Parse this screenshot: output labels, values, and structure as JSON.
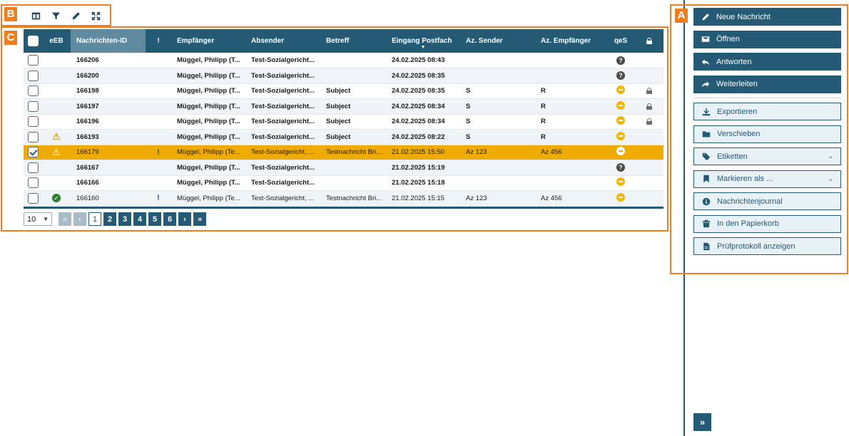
{
  "annotations": {
    "a": "A",
    "b": "B",
    "c": "C"
  },
  "toolbar": {
    "icons": [
      "columns-icon",
      "filter-icon",
      "pen-icon",
      "expand-icon"
    ]
  },
  "table": {
    "headers": {
      "eeb": "eEB",
      "id": "Nachrichten-ID",
      "prio": "!",
      "empf": "Empfänger",
      "abs": "Absender",
      "betreff": "Betreff",
      "eingang": "Eingang Postfach",
      "azs": "Az. Sender",
      "aze": "Az. Empfänger",
      "qes": "qeS"
    },
    "sort_indicator": "▼",
    "rows": [
      {
        "checked": false,
        "eeb": "",
        "id": "166206",
        "prio": "",
        "empf": "Müggel, Philipp (T...",
        "abs": "Test-Sozialgericht...",
        "betreff": "",
        "eingang": "24.02.2025 08:43",
        "azs": "",
        "aze": "",
        "qes": "question",
        "lock": false,
        "bold": true
      },
      {
        "checked": false,
        "eeb": "",
        "id": "166200",
        "prio": "",
        "empf": "Müggel, Philipp (T...",
        "abs": "Test-Sozialgericht...",
        "betreff": "",
        "eingang": "24.02.2025 08:35",
        "azs": "",
        "aze": "",
        "qes": "question",
        "lock": false,
        "bold": true
      },
      {
        "checked": false,
        "eeb": "",
        "id": "166198",
        "prio": "",
        "empf": "Müggel, Philipp (T...",
        "abs": "Test-Sozialgericht...",
        "betreff": "Subject",
        "eingang": "24.02.2025 08:35",
        "azs": "S",
        "aze": "R",
        "qes": "minus",
        "lock": true,
        "bold": true
      },
      {
        "checked": false,
        "eeb": "",
        "id": "166197",
        "prio": "",
        "empf": "Müggel, Philipp (T...",
        "abs": "Test-Sozialgericht...",
        "betreff": "Subject",
        "eingang": "24.02.2025 08:34",
        "azs": "S",
        "aze": "R",
        "qes": "minus",
        "lock": true,
        "bold": true
      },
      {
        "checked": false,
        "eeb": "",
        "id": "166196",
        "prio": "",
        "empf": "Müggel, Philipp (T...",
        "abs": "Test-Sozialgericht...",
        "betreff": "Subject",
        "eingang": "24.02.2025 08:34",
        "azs": "S",
        "aze": "R",
        "qes": "minus",
        "lock": true,
        "bold": true
      },
      {
        "checked": false,
        "eeb": "warning",
        "id": "166193",
        "prio": "",
        "empf": "Müggel, Philipp (T...",
        "abs": "Test-Sozialgericht...",
        "betreff": "Subject",
        "eingang": "24.02.2025 08:22",
        "azs": "S",
        "aze": "R",
        "qes": "minus",
        "lock": false,
        "bold": true
      },
      {
        "checked": true,
        "eeb": "warning",
        "id": "166179",
        "prio": "!",
        "empf": "Müggel, Philipp (Te...",
        "abs": "Test-Sozialgericht, ...",
        "betreff": "Testnachricht Bri...",
        "eingang": "21.02.2025 15:50",
        "azs": "Az 123",
        "aze": "Az 456",
        "qes": "minus",
        "lock": false,
        "bold": false,
        "selected": true
      },
      {
        "checked": false,
        "eeb": "",
        "id": "166167",
        "prio": "",
        "empf": "Müggel, Philipp (T...",
        "abs": "Test-Sozialgericht...",
        "betreff": "",
        "eingang": "21.02.2025 15:19",
        "azs": "",
        "aze": "",
        "qes": "question",
        "lock": false,
        "bold": true
      },
      {
        "checked": false,
        "eeb": "",
        "id": "166166",
        "prio": "",
        "empf": "Müggel, Philipp (T...",
        "abs": "Test-Sozialgericht...",
        "betreff": "",
        "eingang": "21.02.2025 15:18",
        "azs": "",
        "aze": "",
        "qes": "minus",
        "lock": false,
        "bold": true
      },
      {
        "checked": false,
        "eeb": "ok",
        "id": "166160",
        "prio": "!",
        "empf": "Müggel, Philipp (Te...",
        "abs": "Test-Sozialgericht, ...",
        "betreff": "Testnachricht Bri...",
        "eingang": "21.02.2025 15:15",
        "azs": "Az 123",
        "aze": "Az 456",
        "qes": "minus",
        "lock": false,
        "bold": false
      }
    ]
  },
  "pagination": {
    "page_size": "10",
    "first": "«",
    "prev": "‹",
    "pages": [
      "1",
      "2",
      "3",
      "4",
      "5",
      "6"
    ],
    "current": "1",
    "next": "›",
    "last": "»"
  },
  "sidebar": {
    "primary": [
      {
        "label": "Neue Nachricht",
        "icon": "pencil-icon"
      },
      {
        "label": "Öffnen",
        "icon": "envelope-icon"
      },
      {
        "label": "Antworten",
        "icon": "reply-icon"
      },
      {
        "label": "Weiterleiten",
        "icon": "forward-icon"
      }
    ],
    "secondary": [
      {
        "label": "Exportieren",
        "icon": "download-icon",
        "dropdown": false
      },
      {
        "label": "Verschieben",
        "icon": "folder-icon",
        "dropdown": false
      },
      {
        "label": "Etiketten",
        "icon": "tag-icon",
        "dropdown": true
      },
      {
        "label": "Markieren als ...",
        "icon": "bookmark-icon",
        "dropdown": true
      },
      {
        "label": "Nachrichtenjournal",
        "icon": "info-icon",
        "dropdown": false
      },
      {
        "label": "In den Papierkorb",
        "icon": "trash-icon",
        "dropdown": false
      },
      {
        "label": "Prüfprotokoll anzeigen",
        "icon": "document-icon",
        "dropdown": false
      }
    ],
    "collapse_label": "»"
  },
  "colors": {
    "primary": "#245a74",
    "selected_row": "#eeab00",
    "annotation": "#f07d1f"
  }
}
